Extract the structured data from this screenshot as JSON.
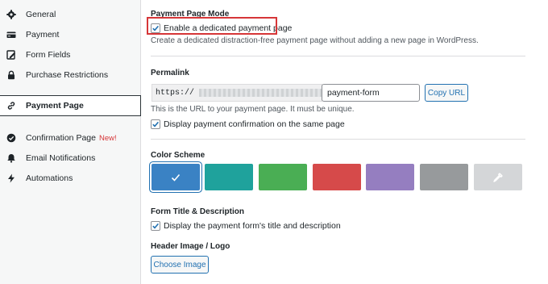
{
  "sidebar": {
    "items": [
      {
        "label": "General",
        "icon": "gear-icon"
      },
      {
        "label": "Payment",
        "icon": "credit-card-icon"
      },
      {
        "label": "Form Fields",
        "icon": "form-fields-icon"
      },
      {
        "label": "Purchase Restrictions",
        "icon": "lock-icon"
      },
      {
        "label": "Payment Page",
        "icon": "link-icon",
        "active": true
      },
      {
        "label": "Confirmation Page",
        "icon": "check-circle-icon",
        "badge": "New!"
      },
      {
        "label": "Email Notifications",
        "icon": "bell-icon"
      },
      {
        "label": "Automations",
        "icon": "lightning-icon"
      }
    ]
  },
  "payment_mode": {
    "title": "Payment Page Mode",
    "checkbox_label": "Enable a dedicated payment page",
    "checked": true,
    "description": "Create a dedicated distraction-free payment page without adding a new page in WordPress."
  },
  "permalink": {
    "title": "Permalink",
    "url_prefix": "https://",
    "slug": "payment-form",
    "copy_button": "Copy URL",
    "description": "This is the URL to your payment page. It must be unique.",
    "confirmation_label": "Display payment confirmation on the same page",
    "confirmation_checked": true
  },
  "color_scheme": {
    "title": "Color Scheme",
    "swatches": [
      {
        "color": "#3a82c4",
        "selected": true,
        "name": "blue"
      },
      {
        "color": "#1fa29c",
        "name": "teal"
      },
      {
        "color": "#4aae54",
        "name": "green"
      },
      {
        "color": "#d64a4a",
        "name": "red"
      },
      {
        "color": "#957ec0",
        "name": "purple"
      },
      {
        "color": "#979a9c",
        "name": "gray"
      },
      {
        "color": "#d4d6d8",
        "name": "custom",
        "icon": "eyedropper-icon"
      }
    ]
  },
  "form_title": {
    "title": "Form Title & Description",
    "checkbox_label": "Display the payment form's title and description",
    "checked": true
  },
  "header_image": {
    "title": "Header Image / Logo",
    "button": "Choose Image"
  },
  "colors": {
    "accent": "#2271b1",
    "highlight": "#d63638"
  }
}
